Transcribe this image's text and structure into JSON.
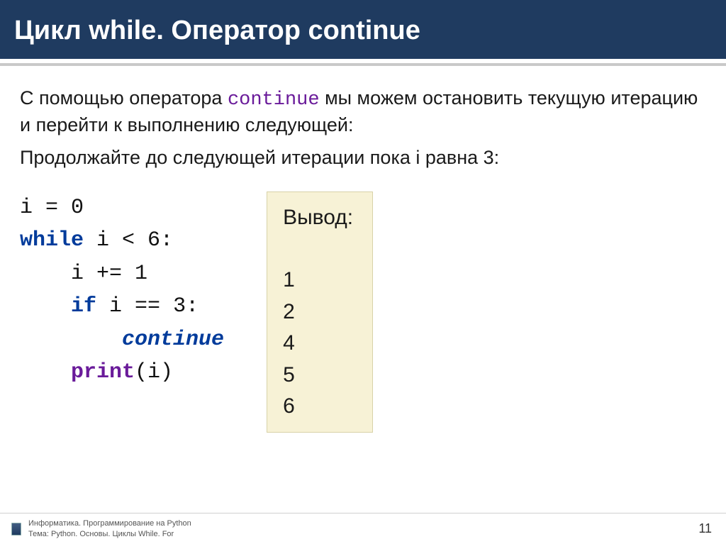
{
  "header": {
    "title": "Цикл while. Оператор continue"
  },
  "body": {
    "desc_pre": "С помощью оператора ",
    "desc_kw": "continue",
    "desc_post": " мы можем остановить текущую итерацию и перейти к выполнению следующей:",
    "desc2": "Продолжайте до следующей итерации пока i равна 3:"
  },
  "code": {
    "l1_a": "i = ",
    "l1_b": "0",
    "l2_a": "while",
    "l2_b": " i < ",
    "l2_c": "6",
    "l2_d": ":",
    "l3_a": "    i += ",
    "l3_b": "1",
    "l4_a": "    ",
    "l4_b": "if",
    "l4_c": " i == ",
    "l4_d": "3",
    "l4_e": ":",
    "l5_a": "        ",
    "l5_b": "continue",
    "l6_a": "    ",
    "l6_b": "print",
    "l6_c": "(i)"
  },
  "output": {
    "label": "Вывод:",
    "lines": [
      "1",
      "2",
      "4",
      "5",
      "6"
    ]
  },
  "footer": {
    "line1": "Информатика. Программирование на Python",
    "line2": "Тема: Python. Основы. Циклы While. For",
    "page": "11"
  }
}
